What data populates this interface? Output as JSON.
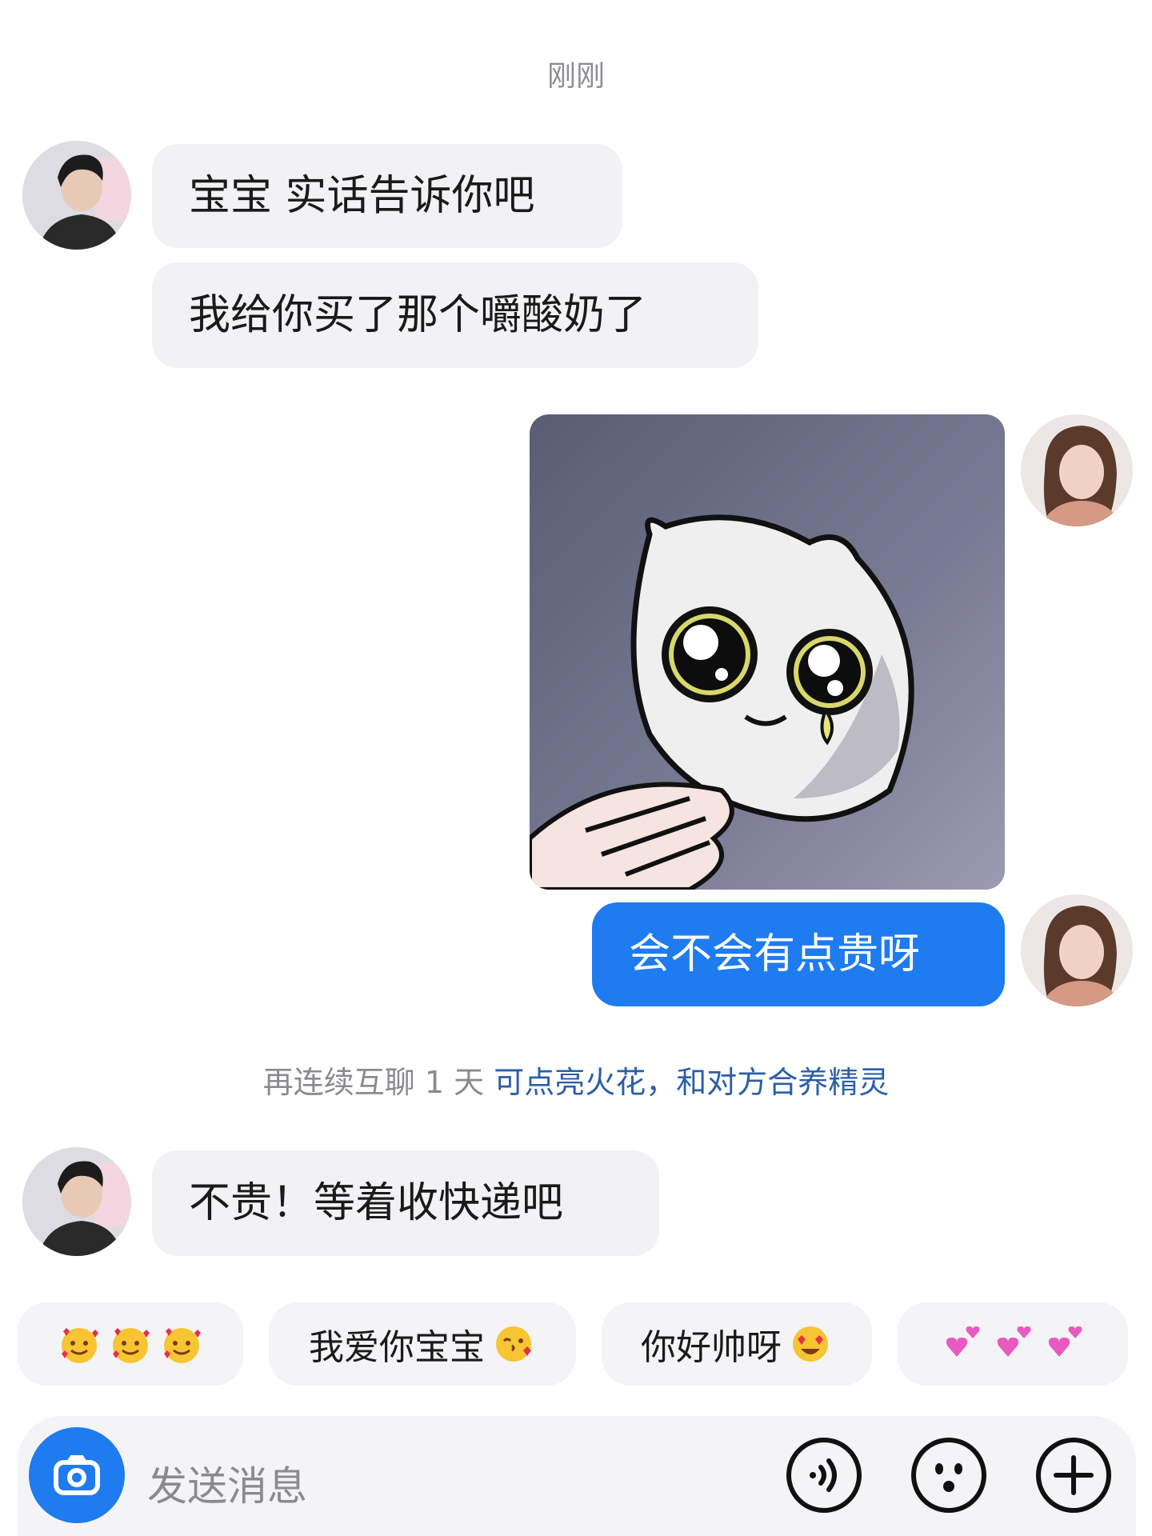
{
  "timestamp": "刚刚",
  "messages": [
    {
      "text": "宝宝 实话告诉你吧"
    },
    {
      "text": "我给你买了那个嚼酸奶了"
    },
    {
      "text": "会不会有点贵呀"
    },
    {
      "text": "不贵！等着收快递吧"
    }
  ],
  "system_tip": {
    "prefix": "再连续互聊 1 天 ",
    "link": "可点亮火花，和对方合养精灵"
  },
  "quick_replies": [
    {
      "text": "",
      "emoji": [
        "smiling-face-with-hearts",
        "smiling-face-with-hearts",
        "smiling-face-with-hearts"
      ]
    },
    {
      "text": "我爱你宝宝",
      "emoji": [
        "face-blowing-kiss"
      ]
    },
    {
      "text": "你好帅呀",
      "emoji": [
        "heart-eyes"
      ]
    },
    {
      "text": "",
      "emoji": [
        "two-hearts",
        "two-hearts",
        "two-hearts"
      ]
    }
  ],
  "input": {
    "placeholder": "发送消息"
  },
  "colors": {
    "outgoing_bubble": "#1e7bf0",
    "incoming_bubble": "#f2f2f5",
    "link": "#2b5fa8"
  }
}
